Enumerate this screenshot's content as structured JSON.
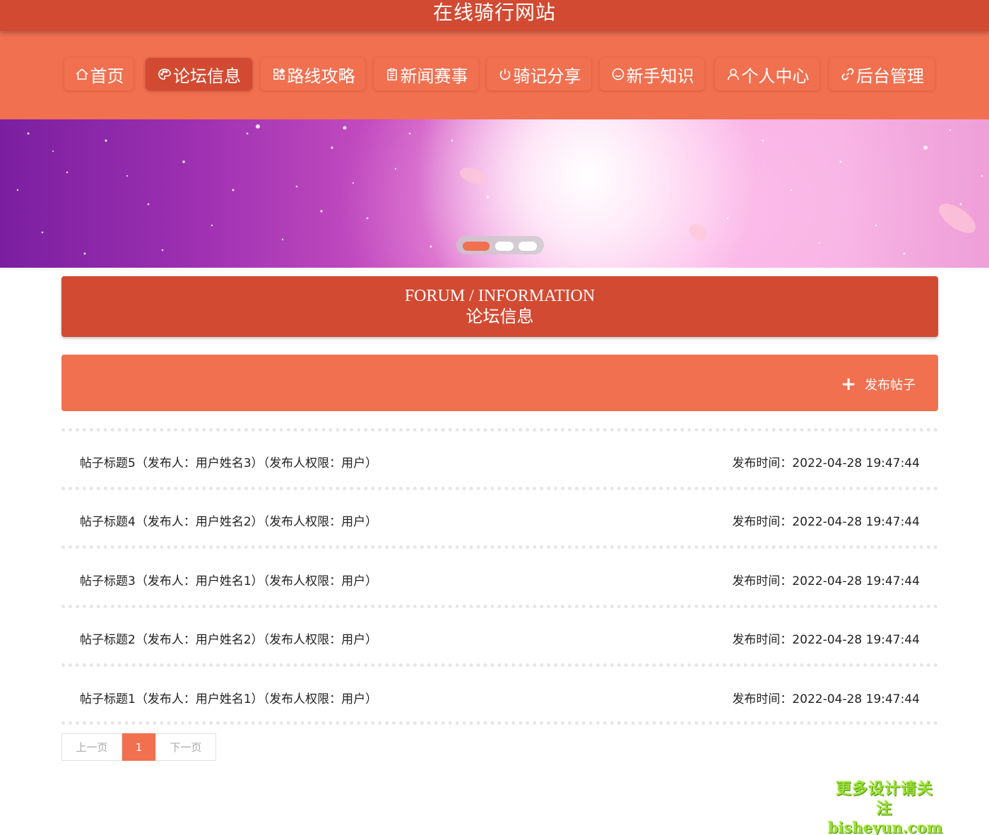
{
  "site": {
    "title": "在线骑行网站"
  },
  "nav": {
    "items": [
      {
        "label": "首页",
        "icon": "home-icon"
      },
      {
        "label": "论坛信息",
        "icon": "palette-icon"
      },
      {
        "label": "路线攻略",
        "icon": "grid-icon"
      },
      {
        "label": "新闻赛事",
        "icon": "clipboard-icon"
      },
      {
        "label": "骑记分享",
        "icon": "power-icon"
      },
      {
        "label": "新手知识",
        "icon": "smile-icon"
      },
      {
        "label": "个人中心",
        "icon": "user-icon"
      },
      {
        "label": "后台管理",
        "icon": "link-icon"
      }
    ],
    "active_index": 1
  },
  "section": {
    "title_en": "FORUM / INFORMATION",
    "title_zh": "论坛信息"
  },
  "actions": {
    "post_label": "发布帖子"
  },
  "posts": [
    {
      "title": "帖子标题5（发布人：用户姓名3）（发布人权限：用户）",
      "time": "发布时间：2022-04-28 19:47:44"
    },
    {
      "title": "帖子标题4（发布人：用户姓名2）（发布人权限：用户）",
      "time": "发布时间：2022-04-28 19:47:44"
    },
    {
      "title": "帖子标题3（发布人：用户姓名1）（发布人权限：用户）",
      "time": "发布时间：2022-04-28 19:47:44"
    },
    {
      "title": "帖子标题2（发布人：用户姓名2）（发布人权限：用户）",
      "time": "发布时间：2022-04-28 19:47:44"
    },
    {
      "title": "帖子标题1（发布人：用户姓名1）（发布人权限：用户）",
      "time": "发布时间：2022-04-28 19:47:44"
    }
  ],
  "pagination": {
    "prev_label": "上一页",
    "current": "1",
    "next_label": "下一页"
  },
  "watermark": {
    "line1": "更多设计请关注",
    "line2": "bisheyun.com"
  },
  "colors": {
    "primary_dark": "#d24a32",
    "primary": "#f07050",
    "watermark": "#9be038"
  }
}
